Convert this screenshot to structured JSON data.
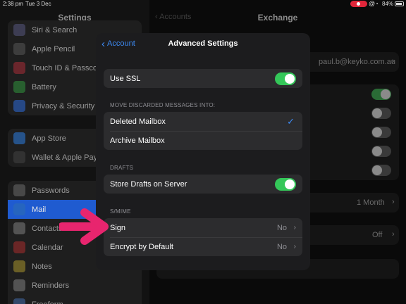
{
  "status": {
    "time": "2:38 pm",
    "date": "Tue 3 Dec",
    "battery": "84%"
  },
  "settings": {
    "title": "Settings",
    "group1": [
      {
        "label": "Siri & Search",
        "icon": "siri-icon",
        "color": "#4a4a6a"
      },
      {
        "label": "Apple Pencil",
        "icon": "pencil-icon",
        "color": "#4a4a4a"
      },
      {
        "label": "Touch ID & Passcode",
        "icon": "fingerprint-icon",
        "color": "#8a2a32"
      },
      {
        "label": "Battery",
        "icon": "battery-icon",
        "color": "#2c7a36"
      },
      {
        "label": "Privacy & Security",
        "icon": "hand-icon",
        "color": "#2a5ab0"
      }
    ],
    "group2": [
      {
        "label": "App Store",
        "icon": "app-store-icon",
        "color": "#2a6ab8"
      },
      {
        "label": "Wallet & Apple Pay",
        "icon": "wallet-icon",
        "color": "#3a3a3a"
      }
    ],
    "group3": [
      {
        "label": "Passwords",
        "icon": "key-icon",
        "color": "#5a5a5a"
      },
      {
        "label": "Mail",
        "icon": "mail-icon",
        "color": "#2a6ab8",
        "selected": true
      },
      {
        "label": "Contacts",
        "icon": "contacts-icon",
        "color": "#6a6a6a"
      },
      {
        "label": "Calendar",
        "icon": "calendar-icon",
        "color": "#8a2a2a"
      },
      {
        "label": "Notes",
        "icon": "notes-icon",
        "color": "#8a7a2a"
      },
      {
        "label": "Reminders",
        "icon": "reminders-icon",
        "color": "#6a6a6a"
      },
      {
        "label": "Freeform",
        "icon": "freeform-icon",
        "color": "#3a5a8a"
      }
    ]
  },
  "exchange": {
    "back": "Accounts",
    "title": "Exchange",
    "account_email": "paul.b@keyko.com.au",
    "mail_days": "1 Month",
    "off_value": "Off"
  },
  "modal": {
    "back_label": "Account",
    "title": "Advanced Settings",
    "use_ssl": "Use SSL",
    "move_header": "MOVE DISCARDED MESSAGES INTO:",
    "deleted_mailbox": "Deleted Mailbox",
    "archive_mailbox": "Archive Mailbox",
    "drafts_header": "DRAFTS",
    "store_drafts": "Store Drafts on Server",
    "smime_header": "S/MIME",
    "sign": "Sign",
    "sign_value": "No",
    "encrypt": "Encrypt by Default",
    "encrypt_value": "No",
    "use_ssl_on": true,
    "store_drafts_on": true
  },
  "colors": {
    "accent": "#3d8bf5",
    "toggle_on": "#34c759",
    "arrow": "#e8256e"
  }
}
